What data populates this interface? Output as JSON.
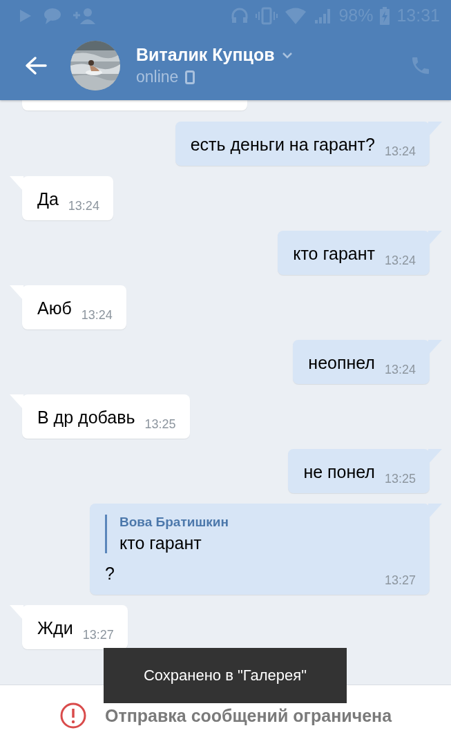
{
  "status_bar": {
    "battery": "98%",
    "time": "13:31"
  },
  "header": {
    "name": "Виталик Купцов",
    "status": "online"
  },
  "messages": [
    {
      "kind": "text",
      "outgoing": true,
      "text": "есть деньги на гарант?",
      "time": "13:24"
    },
    {
      "kind": "text",
      "outgoing": false,
      "text": "Да",
      "time": "13:24"
    },
    {
      "kind": "text",
      "outgoing": true,
      "text": "кто гарант",
      "time": "13:24"
    },
    {
      "kind": "text",
      "outgoing": false,
      "text": "Аюб",
      "time": "13:24"
    },
    {
      "kind": "text",
      "outgoing": true,
      "text": "неопнел",
      "time": "13:24"
    },
    {
      "kind": "text",
      "outgoing": false,
      "text": "В др добавь",
      "time": "13:25"
    },
    {
      "kind": "text",
      "outgoing": true,
      "text": "не понел",
      "time": "13:25"
    },
    {
      "kind": "reply",
      "outgoing": true,
      "quote_author": "Вова Братишкин",
      "quote_text": "кто гарант",
      "text": "?",
      "time": "13:27"
    },
    {
      "kind": "text",
      "outgoing": false,
      "text": "Жди",
      "time": "13:27"
    }
  ],
  "toast": "Сохранено в \"Галерея\"",
  "notice": "Отправка сообщений ограничена"
}
